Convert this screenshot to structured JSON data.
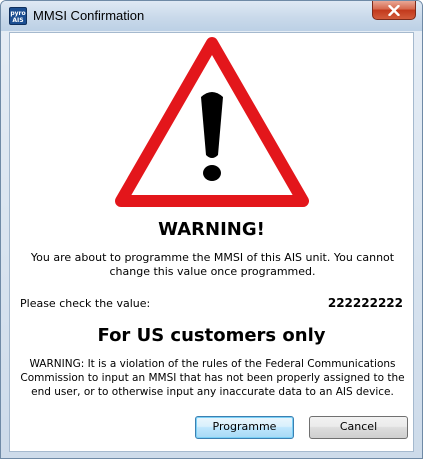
{
  "window": {
    "title": "MMSI Confirmation",
    "app_icon_text": "pyro AIS",
    "close_icon": "close-x-icon"
  },
  "dialog": {
    "graphic_icon": "warning-triangle-icon",
    "heading": "WARNING!",
    "message": "You are about to programme the MMSI of this AIS unit. You cannot change this value once programmed.",
    "check_label": "Please check the value:",
    "mmsi_value": "222222222",
    "us_heading": "For US customers only",
    "fcc_warning": "WARNING: It is a violation of the rules of the Federal Communications Commission to input an MMSI that has not been properly assigned to the end user, or to otherwise input any inaccurate data to an AIS device."
  },
  "buttons": {
    "programme": "Programme",
    "cancel": "Cancel"
  },
  "colors": {
    "warning_red": "#e3161b",
    "close_red": "#c2391c",
    "default_button_border": "#3c7fb1"
  }
}
